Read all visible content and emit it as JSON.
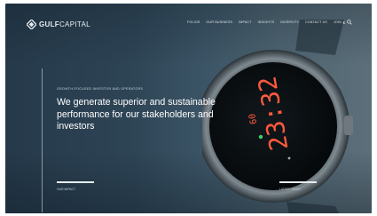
{
  "brand": {
    "name_bold": "GULF",
    "name_rest": "CAPITAL"
  },
  "nav": {
    "items": [
      "FOLIOS",
      "OUR BUSINESS",
      "IMPACT",
      "INSIGHTS",
      "DIVERSITY",
      "CONTACT US",
      "JOIN"
    ],
    "lang": "ع",
    "search_icon": "search-icon"
  },
  "hero": {
    "eyebrow": "GROWTH-FOCUSED INVESTOR AND OPERATORS",
    "headline": "We generate superior and sustainable performance for our stakeholders and investors",
    "link_left": "OUR IMPACT",
    "link_right": "LATEST NEWS",
    "watch_time_main": "23:32",
    "watch_time_small": "60"
  },
  "colors": {
    "background_dark": "#25394a",
    "background_light": "#5c6f7a",
    "text": "#ffffff",
    "watch_digits": "#ff5a3c",
    "watch_accent": "#39d16a"
  }
}
